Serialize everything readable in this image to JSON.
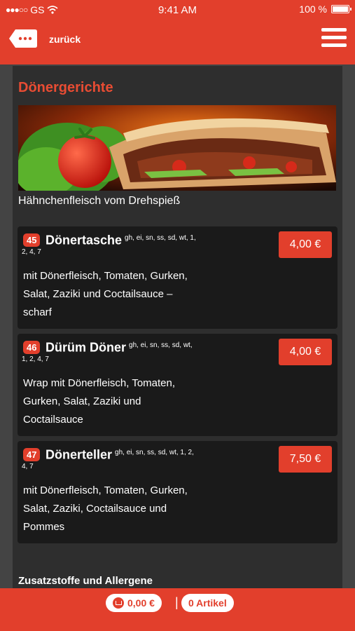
{
  "status_bar": {
    "carrier": "GS",
    "time": "9:41 AM",
    "battery": "100 %"
  },
  "nav": {
    "back_label": "zurück"
  },
  "section": {
    "title": "Dönergerichte",
    "subtitle": "Hähnchenfleisch vom Drehspieß",
    "image_icon": "doner-kebab-image"
  },
  "items": [
    {
      "number": "45",
      "name": "Dönertasche",
      "allergens_1": "gh, ei, sn, ss, sd, wt, 1,",
      "allergens_2": "2, 4, 7",
      "price": "4,00 €",
      "desc_lines": [
        "mit Dönerfleisch, Tomaten, Gurken,",
        "Salat, Zaziki und Coctailsauce –",
        "scharf"
      ]
    },
    {
      "number": "46",
      "name": "Dürüm Döner",
      "allergens_1": "gh, ei, sn, ss, sd, wt,",
      "allergens_2": "1, 2, 4, 7",
      "price": "4,00 €",
      "desc_lines": [
        "Wrap mit Dönerfleisch, Tomaten,",
        "Gurken, Salat, Zaziki und",
        "Coctailsauce"
      ]
    },
    {
      "number": "47",
      "name": "Dönerteller",
      "allergens_1": "gh, ei, sn, ss, sd, wt, 1, 2,",
      "allergens_2": "4, 7",
      "price": "7,50 €",
      "desc_lines": [
        "mit Dönerfleisch, Tomaten, Gurken,",
        "Salat, Zaziki, Coctailsauce und",
        "Pommes"
      ]
    }
  ],
  "footer_peek": "Zusatzstoffe und Allergene",
  "cart": {
    "total": "0,00 €",
    "separator": "|",
    "count": "0 Artikel",
    "icon": "cart-icon"
  },
  "colors": {
    "accent": "#e23f2c",
    "title": "#e84c33",
    "panel": "#2e2e2e",
    "card": "#1a1a1a"
  }
}
